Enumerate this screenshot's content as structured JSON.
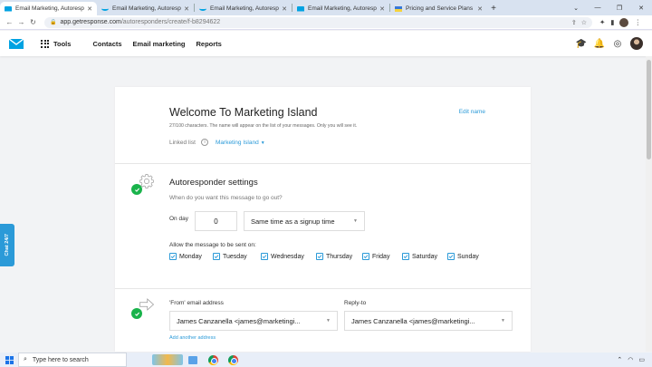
{
  "browser": {
    "tabs": [
      {
        "title": "Email Marketing, Autoresponder",
        "favicon": "mail-favicon",
        "active": true
      },
      {
        "title": "Email Marketing, Autoresponde",
        "favicon": "getresponse-favicon",
        "active": false
      },
      {
        "title": "Email Marketing, Autoresponde",
        "favicon": "getresponse-favicon",
        "active": false
      },
      {
        "title": "Email Marketing, Autoresponde",
        "favicon": "mail-favicon",
        "active": false
      },
      {
        "title": "Pricing and Service Plans | GetR",
        "favicon": "flag-favicon",
        "active": false
      }
    ],
    "url_host": "app.getresponse.com",
    "url_path": "/autoresponders/create/f-b8294622"
  },
  "nav": {
    "tools": "Tools",
    "contacts": "Contacts",
    "email_marketing": "Email marketing",
    "reports": "Reports"
  },
  "message": {
    "title": "Welcome To Marketing Island",
    "edit_name": "Edit name",
    "char_note": "27/100 characters. The name will appear on the list of your messages. Only you will see it.",
    "linked_list_label": "Linked list",
    "linked_list_value": "Marketing Island"
  },
  "settings": {
    "title": "Autoresponder settings",
    "question": "When do you want this message to go out?",
    "on_day_label": "On day",
    "on_day_value": "0",
    "time_option": "Same time as a signup time",
    "allow_label": "Allow the message to be sent on:",
    "days": [
      "Monday",
      "Tuesday",
      "Wednesday",
      "Thursday",
      "Friday",
      "Saturday",
      "Sunday"
    ]
  },
  "sender": {
    "from_label": "'From' email address",
    "from_value": "James Canzanella <james@marketingi...",
    "reply_label": "Reply-to",
    "reply_value": "James Canzanella <james@marketingi...",
    "add_address": "Add another address"
  },
  "chat": {
    "label": "Chat 24/7"
  },
  "taskbar": {
    "search_placeholder": "Type here to search"
  },
  "colors": {
    "accent": "#2b9ad8",
    "success": "#19b34b"
  }
}
